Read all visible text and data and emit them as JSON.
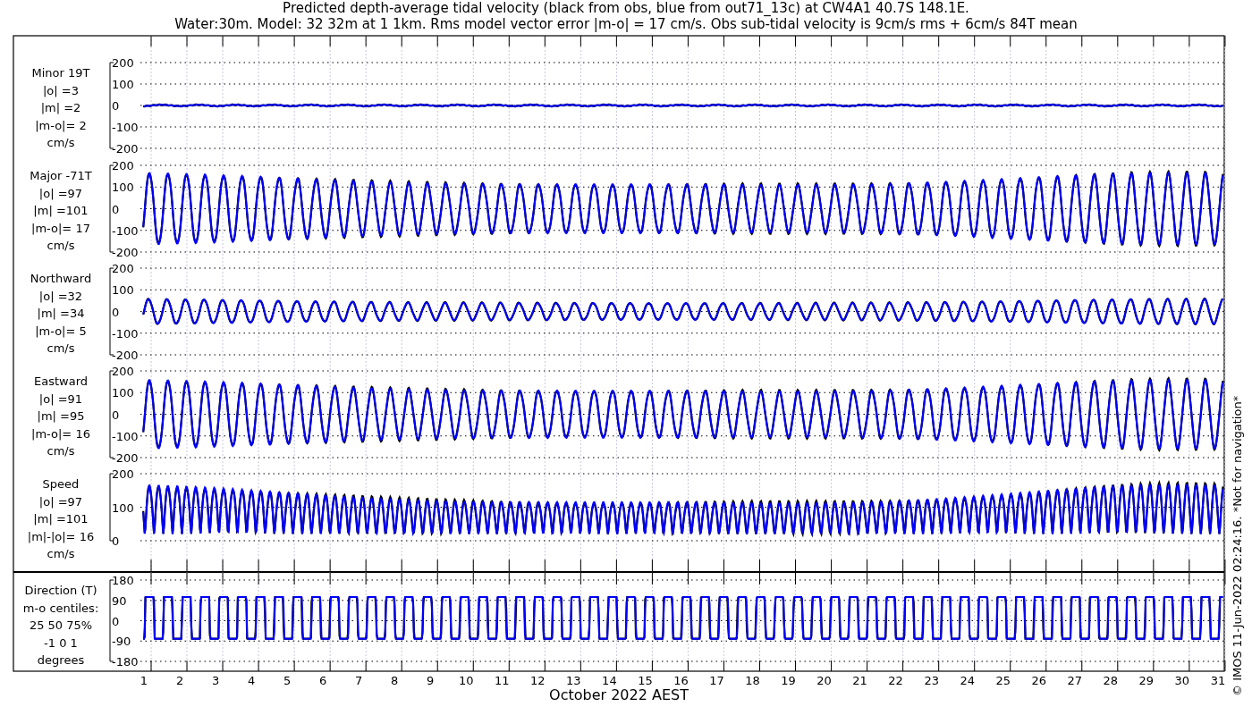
{
  "title": [
    "Predicted depth-average tidal velocity (black from obs, blue from out71_13c) at CW4A1 40.7S 148.1E.",
    "Water:30m. Model: 32 32m at 1 1km. Rms model vector error |m-o| = 17 cm/s. Obs sub-tidal velocity is 9cm/s rms + 6cm/s 84T mean"
  ],
  "panels": [
    {
      "kind": "minor",
      "labels": [
        "Minor 19T",
        "|o| =3",
        "|m| =2",
        "|m-o|= 2",
        "cm/s"
      ],
      "yticks": [
        "200",
        "100",
        "0",
        "-100",
        "-200"
      ]
    },
    {
      "kind": "major",
      "labels": [
        "Major -71T",
        "|o| =97",
        "|m| =101",
        "|m-o|= 17",
        "cm/s"
      ],
      "yticks": [
        "200",
        "100",
        "0",
        "-100",
        "-200"
      ]
    },
    {
      "kind": "northward",
      "labels": [
        "Northward",
        "|o| =32",
        "|m| =34",
        "|m-o|= 5",
        "cm/s"
      ],
      "yticks": [
        "200",
        "100",
        "0",
        "-100",
        "-200"
      ]
    },
    {
      "kind": "eastward",
      "labels": [
        "Eastward",
        "|o| =91",
        "|m| =95",
        "|m-o|= 16",
        "cm/s"
      ],
      "yticks": [
        "200",
        "100",
        "0",
        "-100",
        "-200"
      ]
    },
    {
      "kind": "speed",
      "labels": [
        "Speed",
        "|o| =97",
        "|m| =101",
        "|m|-|o|= 16",
        "cm/s"
      ],
      "yticks": [
        "200",
        "100",
        "0"
      ]
    },
    {
      "kind": "direction",
      "labels": [
        "Direction (T)",
        "m-o centiles:",
        "25  50  75%",
        "-1  0  1",
        "degrees"
      ],
      "yticks": [
        "180",
        "90",
        "0",
        "-90",
        "-180"
      ]
    }
  ],
  "xticks": [
    "1",
    "2",
    "3",
    "4",
    "5",
    "6",
    "7",
    "8",
    "9",
    "10",
    "11",
    "12",
    "13",
    "14",
    "15",
    "16",
    "17",
    "18",
    "19",
    "20",
    "21",
    "22",
    "23",
    "24",
    "25",
    "26",
    "27",
    "28",
    "29",
    "30",
    "31"
  ],
  "xlabel": "October 2022 AEST",
  "side_note": "© IMOS 11-Jun-2022 02:24:16. *Not for navigation*"
}
